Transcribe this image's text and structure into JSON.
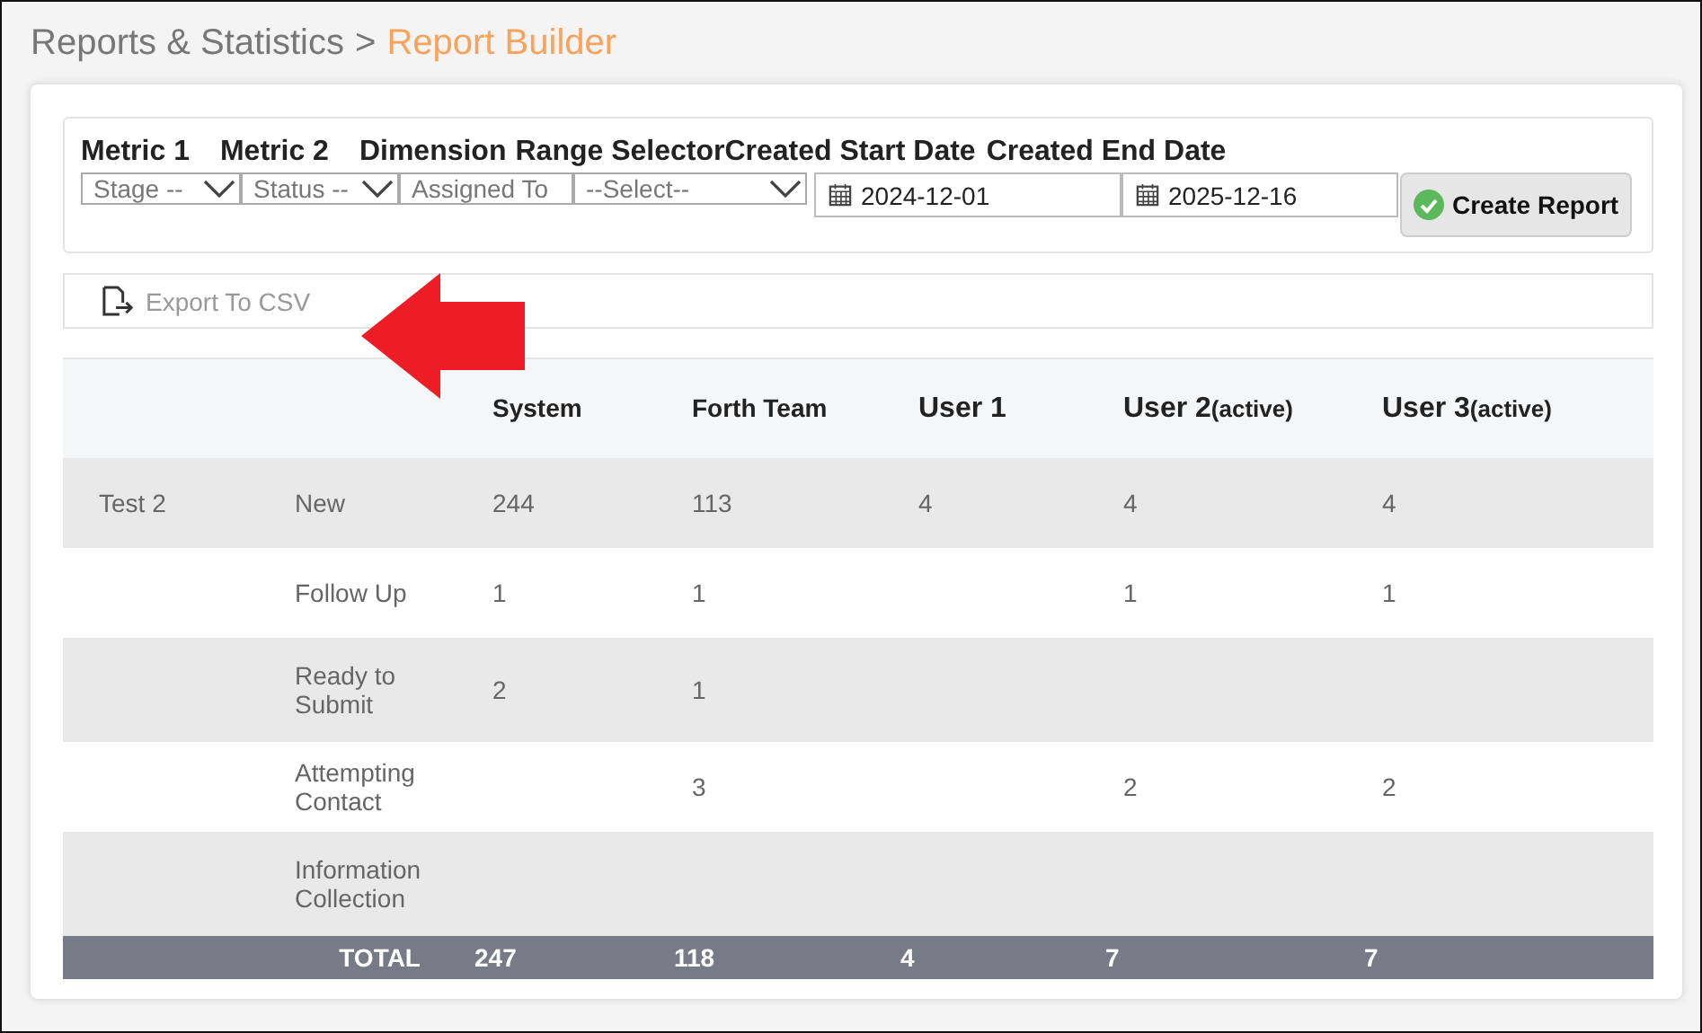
{
  "breadcrumb": {
    "parent": "Reports & Statistics",
    "separator": ">",
    "current": "Report Builder"
  },
  "filters": {
    "labels": [
      "Metric 1",
      "Metric 2",
      "Dimension",
      "Range Selector",
      "Created Start Date",
      "Created End Date"
    ],
    "selects": [
      {
        "value": "Stage --"
      },
      {
        "value": "Status --"
      },
      {
        "value": "Assigned To",
        "kind": "plain"
      },
      {
        "value": "--Select--"
      }
    ],
    "dates": [
      {
        "value": "2024-12-01"
      },
      {
        "value": "2025-12-16"
      }
    ],
    "button": "Create Report"
  },
  "export": {
    "label": "Export To CSV"
  },
  "table": {
    "columns": [
      {
        "name": "System",
        "kind": "team"
      },
      {
        "name": "Forth Team",
        "kind": "team"
      },
      {
        "name": "User 1",
        "kind": "user"
      },
      {
        "name": "User 2",
        "note": "(active)",
        "kind": "user"
      },
      {
        "name": "User 3",
        "note": "(active)",
        "kind": "user"
      }
    ],
    "rows": [
      {
        "group": "Test 2",
        "stage": "New",
        "cells": [
          "244",
          "113",
          "4",
          "4",
          "4"
        ]
      },
      {
        "stage": "Follow Up",
        "cells": [
          "1",
          "1",
          null,
          "1",
          "1"
        ]
      },
      {
        "stage": "Ready to Submit",
        "cells": [
          "2",
          "1",
          null,
          null,
          null
        ]
      },
      {
        "stage": "Attempting Contact",
        "cells": [
          null,
          "3",
          null,
          "2",
          "2"
        ]
      },
      {
        "stage": "Information Collection",
        "cells": [
          null,
          null,
          null,
          null,
          null
        ]
      }
    ],
    "total": {
      "label": "TOTAL",
      "cells": [
        "247",
        "118",
        "4",
        "7",
        "7"
      ]
    }
  }
}
